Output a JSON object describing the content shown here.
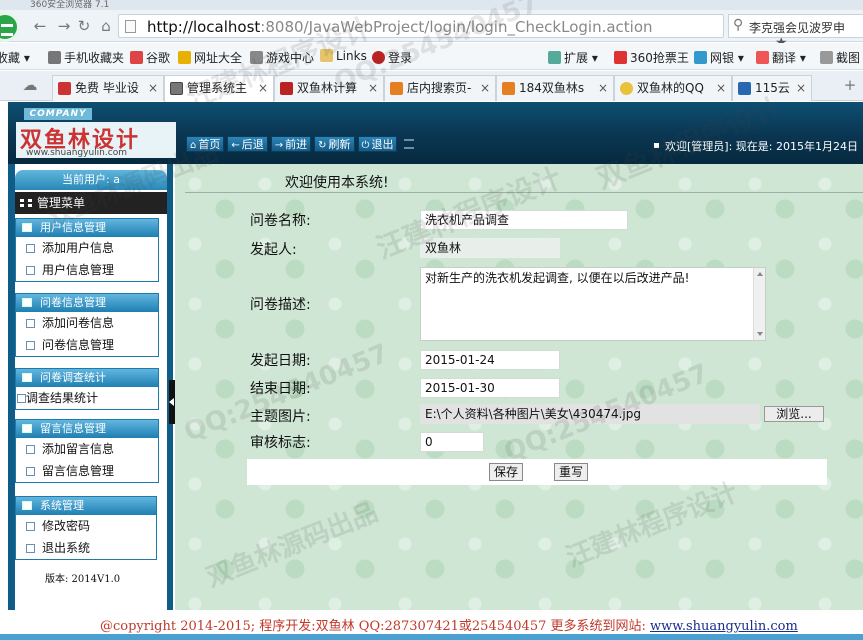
{
  "browser": {
    "title": "360安全浏览器 7.1",
    "url_host": "http://localhost",
    "url_path": ":8080/JavaWebProject/login/login_CheckLogin.action",
    "search_text": "李克强会见波罗申",
    "favorites": [
      "收藏",
      "手机收藏夹",
      "谷歌",
      "网址大全",
      "游戏中心",
      "Links",
      "登录",
      "扩展",
      "360抢票王",
      "网银",
      "翻译",
      "截图"
    ],
    "tabs": [
      "免费 毕业设",
      "管理系统主",
      "双鱼林计算",
      "店内搜索页-",
      "184双鱼林s",
      "双鱼林的QQ",
      "115云"
    ]
  },
  "header": {
    "logo_company": "COMPANY",
    "logo_title": "双鱼林设计",
    "logo_url": "www.shuangyulin.com",
    "nav": [
      "首页",
      "后退",
      "前进",
      "刷新",
      "退出"
    ],
    "welcome_text": "欢迎[管理员]: 现在是: 2015年1月24日"
  },
  "sidebar": {
    "current_user": "当前用户: a",
    "manage_menu": "管理菜单",
    "groups": [
      {
        "title": "用户信息管理",
        "items": [
          "添加用户信息",
          "用户信息管理"
        ]
      },
      {
        "title": "问卷信息管理",
        "items": [
          "添加问卷信息",
          "问卷信息管理"
        ]
      },
      {
        "title": "问卷调查统计",
        "items": [
          "调查结果统计"
        ]
      },
      {
        "title": "留言信息管理",
        "items": [
          "添加留言信息",
          "留言信息管理"
        ]
      },
      {
        "title": "系统管理",
        "items": [
          "修改密码",
          "退出系统"
        ]
      }
    ],
    "version": "版本: 2014V1.0"
  },
  "content": {
    "welcome": "欢迎使用本系统!",
    "form": {
      "name_label": "问卷名称:",
      "name_value": "洗衣机产品调查",
      "initiator_label": "发起人:",
      "initiator_value": "双鱼林",
      "desc_label": "问卷描述:",
      "desc_value": "对新生产的洗衣机发起调查, 以便在以后改进产品!",
      "start_label": "发起日期:",
      "start_value": "2015-01-24",
      "end_label": "结束日期:",
      "end_value": "2015-01-30",
      "image_label": "主题图片:",
      "image_value": "E:\\个人资料\\各种图片\\美女\\430474.jpg",
      "browse_label": "浏览...",
      "audit_label": "审核标志:",
      "audit_value": "0",
      "save_label": "保存",
      "reset_label": "重写"
    }
  },
  "footer": {
    "text": "@copyright 2014-2015; 程序开发:双鱼林 QQ:287307421或254540457 更多系统到网站: ",
    "link": "www.shuangyulin.com"
  },
  "watermarks": [
    "汪建林程序设计",
    "QQ:254540457",
    "双鱼林源码出品",
    "双鱼林程序设计"
  ]
}
